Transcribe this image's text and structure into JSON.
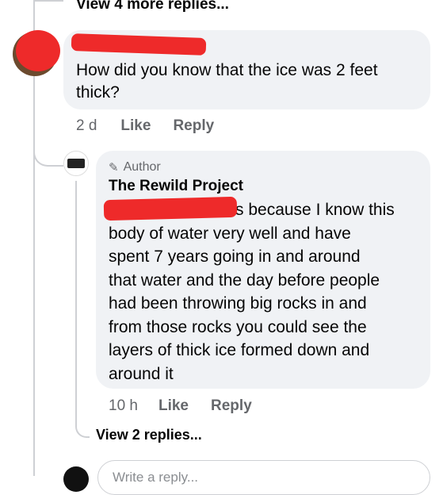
{
  "top_thread": {
    "view_more_label": "View 4 more replies..."
  },
  "comment": {
    "author_name": "",
    "text": "How did you know that the ice was 2 feet thick?",
    "time": "2 d",
    "like_label": "Like",
    "reply_label": "Reply"
  },
  "reply": {
    "badge_label": "Author",
    "author_name": "The Rewild Project",
    "lines": [
      "s because I know this",
      "body of water very well and have",
      "spent 7 years going in and around",
      "that water and the day before people",
      "had been throwing big rocks in and",
      "from those rocks you could see the",
      "layers of thick ice formed down and",
      "around it"
    ],
    "time": "10 h",
    "like_label": "Like",
    "reply_label": "Reply"
  },
  "view_replies_label": "View 2 replies...",
  "composer": {
    "placeholder": "Write a reply..."
  },
  "colors": {
    "redaction": "#ee2a2a",
    "bubble": "#f0f2f5",
    "meta": "#65676b",
    "thread_line": "#ced0d4"
  }
}
